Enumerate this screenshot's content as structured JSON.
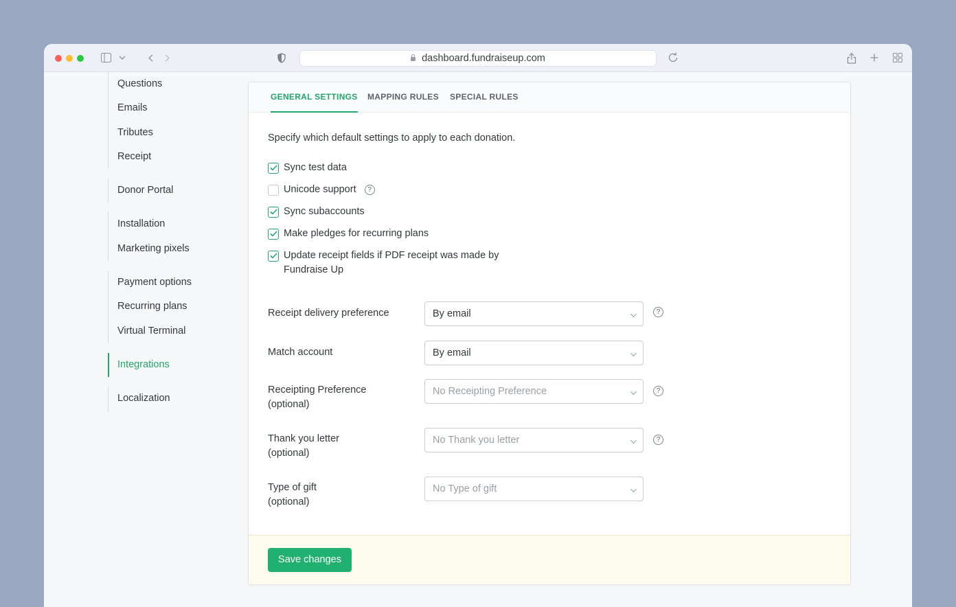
{
  "browser": {
    "url": "dashboard.fundraiseup.com"
  },
  "sidebar": {
    "groups": [
      {
        "items": [
          "Questions",
          "Emails",
          "Tributes",
          "Receipt"
        ]
      },
      {
        "items": [
          "Donor Portal"
        ]
      },
      {
        "items": [
          "Installation",
          "Marketing pixels"
        ]
      },
      {
        "items": [
          "Payment options",
          "Recurring plans",
          "Virtual Terminal"
        ]
      },
      {
        "items": [
          "Integrations"
        ],
        "active": true
      },
      {
        "items": [
          "Localization"
        ]
      }
    ]
  },
  "tabs": [
    {
      "label": "GENERAL SETTINGS",
      "active": true
    },
    {
      "label": "MAPPING RULES",
      "active": false
    },
    {
      "label": "SPECIAL RULES",
      "active": false
    }
  ],
  "description": "Specify which default settings to apply to each donation.",
  "checkboxes": [
    {
      "label": "Sync test data",
      "checked": true,
      "help": false
    },
    {
      "label": "Unicode support",
      "checked": false,
      "help": true
    },
    {
      "label": "Sync subaccounts",
      "checked": true,
      "help": false
    },
    {
      "label": "Make pledges for recurring plans",
      "checked": true,
      "help": false
    },
    {
      "label": "Update receipt fields if PDF receipt was made by",
      "label2": "Fundraise Up",
      "checked": true,
      "help": false
    }
  ],
  "fields": [
    {
      "label": "Receipt delivery preference",
      "optional": "",
      "value": "By email",
      "placeholder": false,
      "help": true
    },
    {
      "label": "Match account",
      "optional": "",
      "value": "By email",
      "placeholder": false,
      "help": false
    },
    {
      "label": "Receipting Preference",
      "optional": "(optional)",
      "value": "No Receipting Preference",
      "placeholder": true,
      "help": true
    },
    {
      "label": "Thank you letter",
      "optional": "(optional)",
      "value": "No Thank you letter",
      "placeholder": true,
      "help": true
    },
    {
      "label": "Type of gift",
      "optional": "(optional)",
      "value": "No Type of gift",
      "placeholder": true,
      "help": false
    }
  ],
  "footer": {
    "save_label": "Save changes"
  },
  "colors": {
    "accent": "#20a76b",
    "background": "#97a8c0",
    "footer_bg": "#fdfcef"
  }
}
